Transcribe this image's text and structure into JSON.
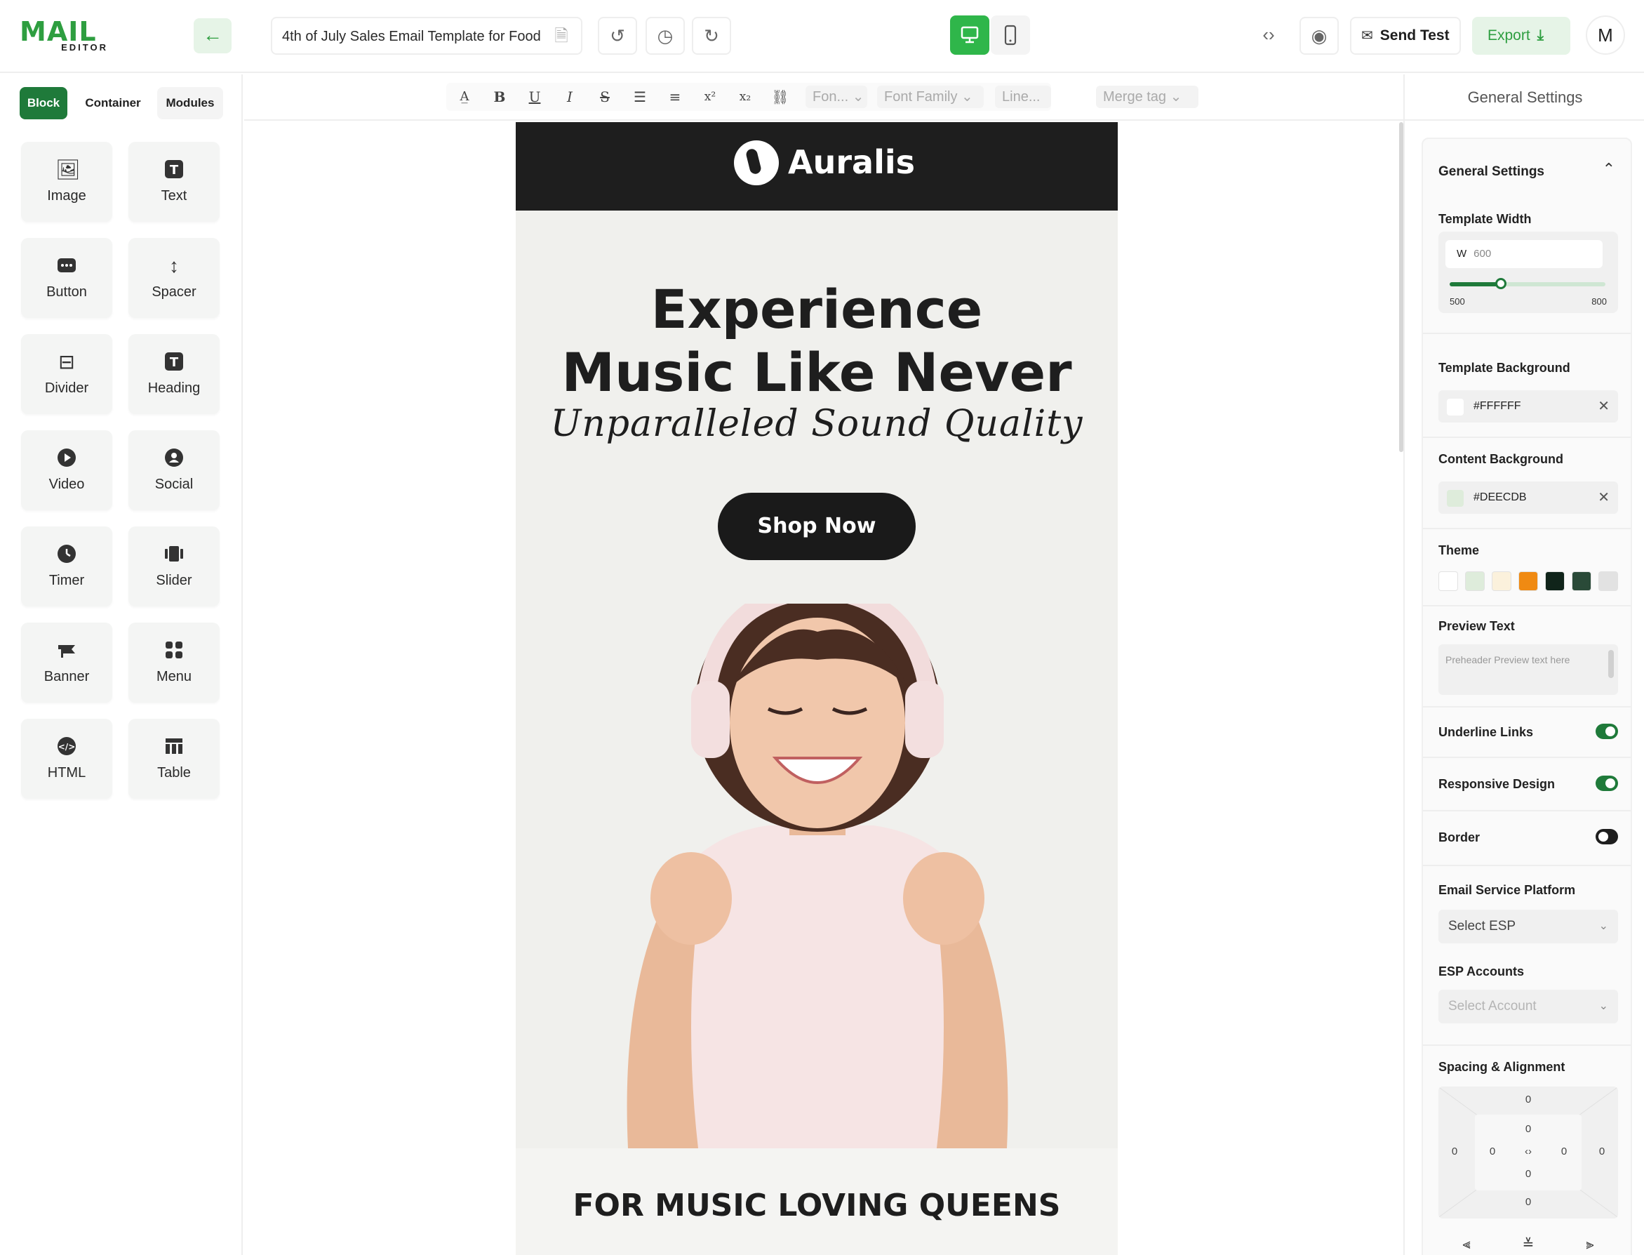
{
  "app": {
    "logo_text": "MAIL",
    "logo_sub": "EDITOR",
    "document_title": "4th of July Sales Email Template for Food",
    "send_test_label": "Send Test",
    "export_label": "Export",
    "avatar_initial": "M"
  },
  "left_panel": {
    "tabs": [
      {
        "label": "Block",
        "active": true
      },
      {
        "label": "Container",
        "active": false
      },
      {
        "label": "Modules",
        "active": false
      }
    ],
    "blocks": [
      {
        "label": "Image",
        "icon": "image-icon"
      },
      {
        "label": "Text",
        "icon": "text-icon"
      },
      {
        "label": "Button",
        "icon": "button-icon"
      },
      {
        "label": "Spacer",
        "icon": "spacer-icon"
      },
      {
        "label": "Divider",
        "icon": "divider-icon"
      },
      {
        "label": "Heading",
        "icon": "heading-icon"
      },
      {
        "label": "Video",
        "icon": "video-icon"
      },
      {
        "label": "Social",
        "icon": "social-icon"
      },
      {
        "label": "Timer",
        "icon": "timer-icon"
      },
      {
        "label": "Slider",
        "icon": "slider-icon"
      },
      {
        "label": "Banner",
        "icon": "banner-icon"
      },
      {
        "label": "Menu",
        "icon": "menu-icon"
      },
      {
        "label": "HTML",
        "icon": "html-icon"
      },
      {
        "label": "Table",
        "icon": "table-icon"
      }
    ]
  },
  "format_bar": {
    "font_size_placeholder": "Fon...",
    "font_family_placeholder": "Font Family",
    "line_height_placeholder": "Line...",
    "merge_tag_placeholder": "Merge tag"
  },
  "email": {
    "brand": "Auralis",
    "headline_line1": "Experience",
    "headline_line2": "Music Like Never",
    "tagline": "Unparalleled Sound Quality",
    "cta": "Shop Now",
    "section_title": "FOR MUSIC LOVING QUEENS"
  },
  "right_panel": {
    "header": "General Settings",
    "section_title": "General Settings",
    "template_width": {
      "label": "Template Width",
      "prefix": "W",
      "value": "600",
      "min": "500",
      "max": "800",
      "fraction": 0.33
    },
    "template_background": {
      "label": "Template Background",
      "value": "#FFFFFF",
      "swatch": "#FFFFFF"
    },
    "content_background": {
      "label": "Content Background",
      "value": "#DEECDB",
      "swatch": "#DEECDB"
    },
    "theme": {
      "label": "Theme",
      "swatches": [
        "#FFFFFF",
        "#DEECDB",
        "#FBF1DC",
        "#F08A12",
        "#10241A",
        "#2A4A38",
        "#E2E2E2"
      ]
    },
    "preview_text": {
      "label": "Preview Text",
      "placeholder": "Preheader Preview text here"
    },
    "underline_links": {
      "label": "Underline Links",
      "on": true
    },
    "responsive_design": {
      "label": "Responsive Design",
      "on": true
    },
    "border": {
      "label": "Border",
      "on": false
    },
    "esp": {
      "label": "Email Service Platform",
      "placeholder": "Select ESP"
    },
    "esp_accounts": {
      "label": "ESP Accounts",
      "placeholder": "Select Account"
    },
    "spacing": {
      "label": "Spacing & Alignment",
      "outer_top": "0",
      "inner_top": "0",
      "outer_left": "0",
      "inner_left": "0",
      "inner_right": "0",
      "outer_right": "0",
      "inner_bottom": "0",
      "outer_bottom": "0"
    }
  }
}
